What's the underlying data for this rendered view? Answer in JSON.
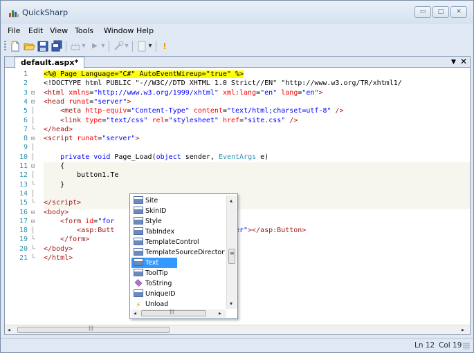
{
  "window": {
    "title": "QuickSharp",
    "minimize": "▭",
    "maximize": "□",
    "close": "✕"
  },
  "menu": [
    "File",
    "Edit",
    "View",
    "Tools",
    "Window",
    "Help"
  ],
  "tab": {
    "label": "default.aspx*",
    "dropdown": "▼",
    "close": "✕"
  },
  "code": [
    {
      "n": "1",
      "fold": "",
      "html": "<span class=\"dir-hl\">&lt;%@ Page Language=\"C#\" AutoEventWireup=\"true\" %&gt;</span>"
    },
    {
      "n": "2",
      "fold": "",
      "html": "&lt;!DOCTYPE html PUBLIC \"-//W3C//DTD XHTML 1.0 Strict//EN\" \"http://www.w3.org/TR/xhtml1/"
    },
    {
      "n": "3",
      "fold": "⊟",
      "html": "<span class=\"tag\">&lt;html</span> <span class=\"attr\">xmlns</span>=<span class=\"val\">\"http://www.w3.org/1999/xhtml\"</span> <span class=\"attr\">xml:lang</span>=<span class=\"val\">\"en\"</span> <span class=\"attr\">lang</span>=<span class=\"val\">\"en\"</span><span class=\"tag\">&gt;</span>"
    },
    {
      "n": "4",
      "fold": "⊟",
      "html": "<span class=\"tag\">&lt;head</span> <span class=\"attr\">runat</span>=<span class=\"val\">\"server\"</span><span class=\"tag\">&gt;</span>"
    },
    {
      "n": "5",
      "fold": "│",
      "html": "    <span class=\"tag\">&lt;meta</span> <span class=\"attr\">http-equiv</span>=<span class=\"val\">\"Content-Type\"</span> <span class=\"attr\">content</span>=<span class=\"val\">\"text/html;charset=utf-8\"</span> <span class=\"tag\">/&gt;</span>"
    },
    {
      "n": "6",
      "fold": "│",
      "html": "    <span class=\"tag\">&lt;link</span> <span class=\"attr\">type</span>=<span class=\"val\">\"text/css\"</span> <span class=\"attr\">rel</span>=<span class=\"val\">\"stylesheet\"</span> <span class=\"attr\">href</span>=<span class=\"val\">\"site.css\"</span> <span class=\"tag\">/&gt;</span>"
    },
    {
      "n": "7",
      "fold": "└",
      "html": "<span class=\"tag\">&lt;/head&gt;</span>"
    },
    {
      "n": "8",
      "fold": "⊟",
      "html": "<span class=\"tag\">&lt;script</span> <span class=\"attr\">runat</span>=<span class=\"val\">\"server\"</span><span class=\"tag\">&gt;</span>"
    },
    {
      "n": "9",
      "fold": "│",
      "html": ""
    },
    {
      "n": "10",
      "fold": "│",
      "html": "    <span class=\"kw\">private</span> <span class=\"kw\">void</span> Page_Load(<span class=\"kw\">object</span> sender, <span class=\"type\">EventArgs</span> e)"
    },
    {
      "n": "11",
      "fold": "⊟",
      "html": "    {"
    },
    {
      "n": "12",
      "fold": "│",
      "html": "        button1.Te"
    },
    {
      "n": "13",
      "fold": "└",
      "html": "    }"
    },
    {
      "n": "14",
      "fold": "│",
      "html": ""
    },
    {
      "n": "15",
      "fold": "└",
      "html": "<span class=\"tag\">&lt;/script&gt;</span>"
    },
    {
      "n": "16",
      "fold": "⊟",
      "html": "<span class=\"tag\">&lt;body&gt;</span>"
    },
    {
      "n": "17",
      "fold": "⊟",
      "html": "    <span class=\"tag\">&lt;form</span> <span class=\"attr\">id</span>=<span class=\"val\">\"for</span>"
    },
    {
      "n": "18",
      "fold": "│",
      "html": "        <span class=\"tag\">&lt;asp:Butt</span>                        <span class=\"val\">\"server\"</span><span class=\"tag\">&gt;&lt;/asp:Button&gt;</span>"
    },
    {
      "n": "19",
      "fold": "└",
      "html": "    <span class=\"tag\">&lt;/form&gt;</span>"
    },
    {
      "n": "20",
      "fold": "└",
      "html": "<span class=\"tag\">&lt;/body&gt;</span>"
    },
    {
      "n": "21",
      "fold": "└",
      "html": "<span class=\"tag\">&lt;/html&gt;</span>"
    }
  ],
  "completion": {
    "items": [
      {
        "label": "Site",
        "icon": "property-icon"
      },
      {
        "label": "SkinID",
        "icon": "property-icon"
      },
      {
        "label": "Style",
        "icon": "property-icon"
      },
      {
        "label": "TabIndex",
        "icon": "property-icon"
      },
      {
        "label": "TemplateControl",
        "icon": "property-icon"
      },
      {
        "label": "TemplateSourceDirectory",
        "icon": "property-icon"
      },
      {
        "label": "Text",
        "icon": "property-icon",
        "selected": true
      },
      {
        "label": "ToolTip",
        "icon": "property-icon"
      },
      {
        "label": "ToString",
        "icon": "method-icon"
      },
      {
        "label": "UniqueID",
        "icon": "property-icon"
      },
      {
        "label": "Unload",
        "icon": "event-icon"
      }
    ],
    "scroll_position": 0.55
  },
  "status": {
    "line": "Ln 12",
    "col": "Col 19"
  },
  "colors": {
    "chrome": "#dfe8f3",
    "selection": "#3399ff",
    "highlight": "#ffff00"
  }
}
